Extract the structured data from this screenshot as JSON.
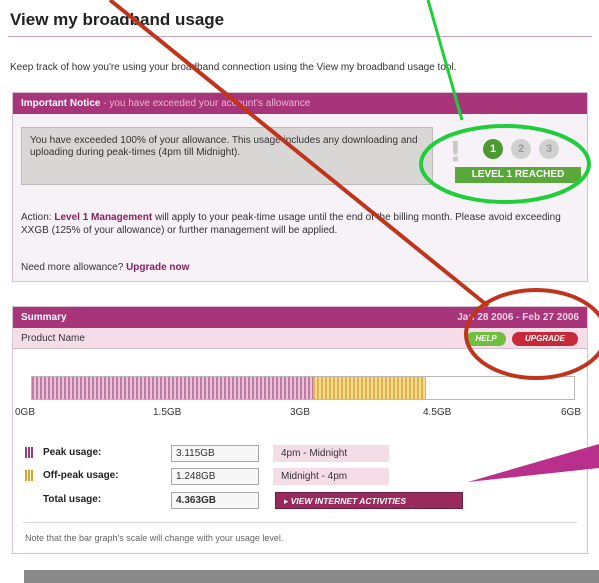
{
  "page": {
    "title": "View my broadband usage",
    "intro": "Keep track of how you're using your broadband connection using the View my broadband usage tool."
  },
  "notice": {
    "header_bold": "Important Notice",
    "header_rest": " - you have exceeded your account's allowance",
    "message": "You have exceeded 100% of your allowance. This usage includes any downloading and uploading during peak-times (4pm till Midnight).",
    "level_marker": "!",
    "levels": [
      "1",
      "2",
      "3"
    ],
    "current_level": 1,
    "level_reached": "LEVEL 1 REACHED",
    "action_prefix": "Action: ",
    "action_link": "Level 1 Management",
    "action_text": " will apply to your peak-time usage until the end of the billing month. Please avoid exceeding XXGB (125% of your allowance) or further management will be applied.",
    "need_more_text": "Need more allowance? ",
    "upgrade_link": "Upgrade now"
  },
  "summary": {
    "header": "Summary",
    "date_range": "Jan 28 2006 - Feb 27 2006",
    "product_name": "Product Name",
    "help_button": "HELP",
    "upgrade_button": "UPGRADE",
    "bar_scale_max_gb": 6,
    "peak_gb": 3.115,
    "offpeak_gb": 1.248,
    "peak_color": "#c27aa4",
    "offpeak_color": "#e0b44a",
    "ticks": [
      "0GB",
      "1.5GB",
      "3GB",
      "4.5GB",
      "6GB"
    ],
    "rows": {
      "peak": {
        "label": "Peak usage:",
        "value": "3.115GB",
        "time": "4pm - Midnight"
      },
      "offpeak": {
        "label": "Off-peak usage:",
        "value": "1.248GB",
        "time": "Midnight - 4pm"
      },
      "total": {
        "label": "Total usage:",
        "value": "4.363GB"
      }
    },
    "view_button": "▸ VIEW INTERNET ACTIVITIES",
    "note": "Note that the bar graph's scale will change with your usage level."
  },
  "colors": {
    "brand": "#a8347a",
    "level_green": "#4a9a2f",
    "annotation_red": "#c0341b",
    "annotation_green": "#1fcf3a",
    "annotation_magenta": "#b8308c"
  }
}
